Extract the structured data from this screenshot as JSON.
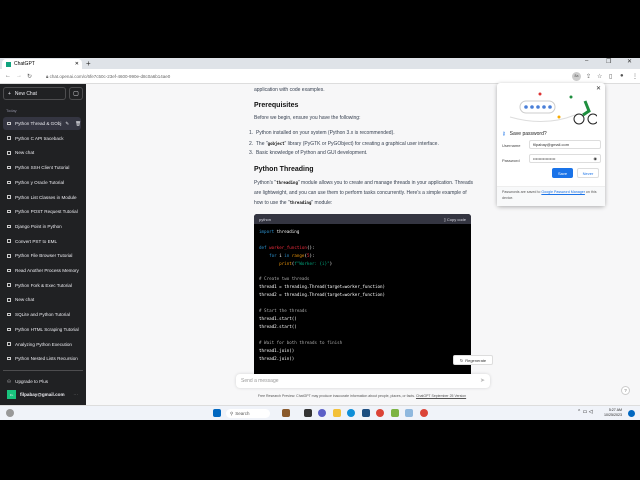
{
  "browser": {
    "tab_title": "ChatGPT",
    "url": "chat.openai.com/c/6fe7c50c-23ef-4600-990e-d8c0a6b14ae0",
    "profile_badge": "8a"
  },
  "sidebar": {
    "new_chat": "New Chat",
    "section": "Today",
    "items": [
      {
        "label": "Python Thread & GObj",
        "active": true
      },
      {
        "label": "Python C API traceback"
      },
      {
        "label": "New chat"
      },
      {
        "label": "Python SSH Client Tutorial"
      },
      {
        "label": "Python y Oracle Tutorial"
      },
      {
        "label": "Python List Classes in Module"
      },
      {
        "label": "Python POST Request Tutorial"
      },
      {
        "label": "Django Point in Python"
      },
      {
        "label": "Convert PST to EML"
      },
      {
        "label": "Python File Browser Tutorial"
      },
      {
        "label": "Read Another Process Memory"
      },
      {
        "label": "Python Fork & Exec Tutorial"
      },
      {
        "label": "New chat"
      },
      {
        "label": "SQLite and Python Tutorial"
      },
      {
        "label": "Python HTML Scraping Tutorial"
      },
      {
        "label": "Analyzing Python Execution"
      },
      {
        "label": "Python Nested Lists Recursion"
      }
    ],
    "upgrade": "Upgrade to Plus",
    "avatar_initials": "FL",
    "user_email": "filpabay@gmail.com"
  },
  "content": {
    "intro": "application with code examples.",
    "h_prereq": "Prerequisites",
    "prereq_intro": "Before we begin, ensure you have the following:",
    "prereqs": [
      {
        "pre": "Python installed on your system (Python 3.x is recommended).",
        "code": "",
        "post": ""
      },
      {
        "pre": "The ",
        "code": "gobject",
        "post": " library (PyGTK or PyGObject) for creating a graphical user interface."
      },
      {
        "pre": "Basic knowledge of Python and GUI development.",
        "code": "",
        "post": ""
      }
    ],
    "h_threading": "Python Threading",
    "p1a": "Python's ",
    "p1code": "threading",
    "p1b": " module allows you to create and manage threads in your application. Threads are lightweight, and you can use them to perform tasks concurrently. Here's a simple example of how to use the ",
    "p1code2": "threading",
    "p1c": " module:",
    "code_lang": "python",
    "copy_label": "Copy code"
  },
  "regenerate": "Regenerate",
  "message_placeholder": "Send a message",
  "footer": {
    "text": "Free Research Preview. ChatGPT may produce inaccurate information about people, places, or facts.",
    "link": "ChatGPT September 25 Version"
  },
  "popup": {
    "title": "Save password?",
    "username_label": "Username",
    "username": "filpabay@gmail.com",
    "password_label": "Password",
    "password": "••••••••••••••••",
    "save": "Save",
    "never": "Never",
    "note": "Passwords are saved to ",
    "note_link": "Google Password Manager",
    "note_end": " on this device."
  },
  "taskbar": {
    "search": "Search",
    "time": "5:27 AM",
    "date": "10/25/2023"
  },
  "colors": {
    "sidebar": "#202123",
    "accent": "#1a73e8"
  }
}
